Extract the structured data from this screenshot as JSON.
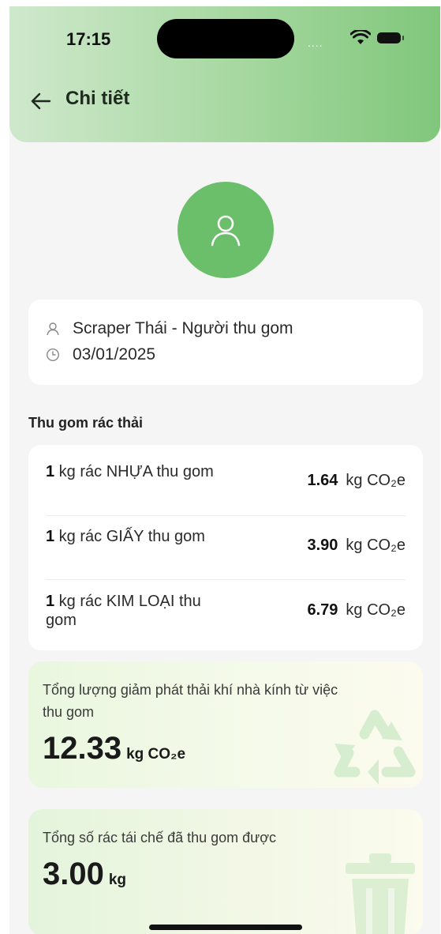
{
  "status_bar": {
    "time": "17:15",
    "signal": "....",
    "icons": [
      "wifi-icon",
      "battery-icon"
    ]
  },
  "header": {
    "title": "Chi tiết",
    "back_icon": "arrow-left-icon"
  },
  "avatar": {
    "icon": "user-icon"
  },
  "info": {
    "collector": "Scraper Thái - Người thu gom",
    "date": "03/01/2025"
  },
  "section": {
    "title": "Thu gom rác thải"
  },
  "waste_items": [
    {
      "qty": "1",
      "desc": " kg rác NHỰA thu gom",
      "value": "1.64",
      "unit": "kg CO₂e"
    },
    {
      "qty": "1",
      "desc": " kg rác GIẤY thu gom",
      "value": "3.90",
      "unit": "kg CO₂e"
    },
    {
      "qty": "1",
      "desc": " kg rác KIM LOẠI thu gom",
      "value": "6.79",
      "unit": "kg CO₂e"
    }
  ],
  "emission_total": {
    "label": "Tổng lượng giảm phát thải khí nhà kính từ việc thu gom",
    "value": "12.33",
    "unit": "kg CO₂e",
    "icon": "recycle-icon"
  },
  "recycled_total": {
    "label": "Tổng số rác tái chế đã thu gom được",
    "value": "3.00",
    "unit": "kg",
    "icon": "trash-bin-icon"
  },
  "colors": {
    "accent": "#6bbf6a",
    "header_start": "#cfe8cc",
    "header_end": "#80c77b"
  }
}
